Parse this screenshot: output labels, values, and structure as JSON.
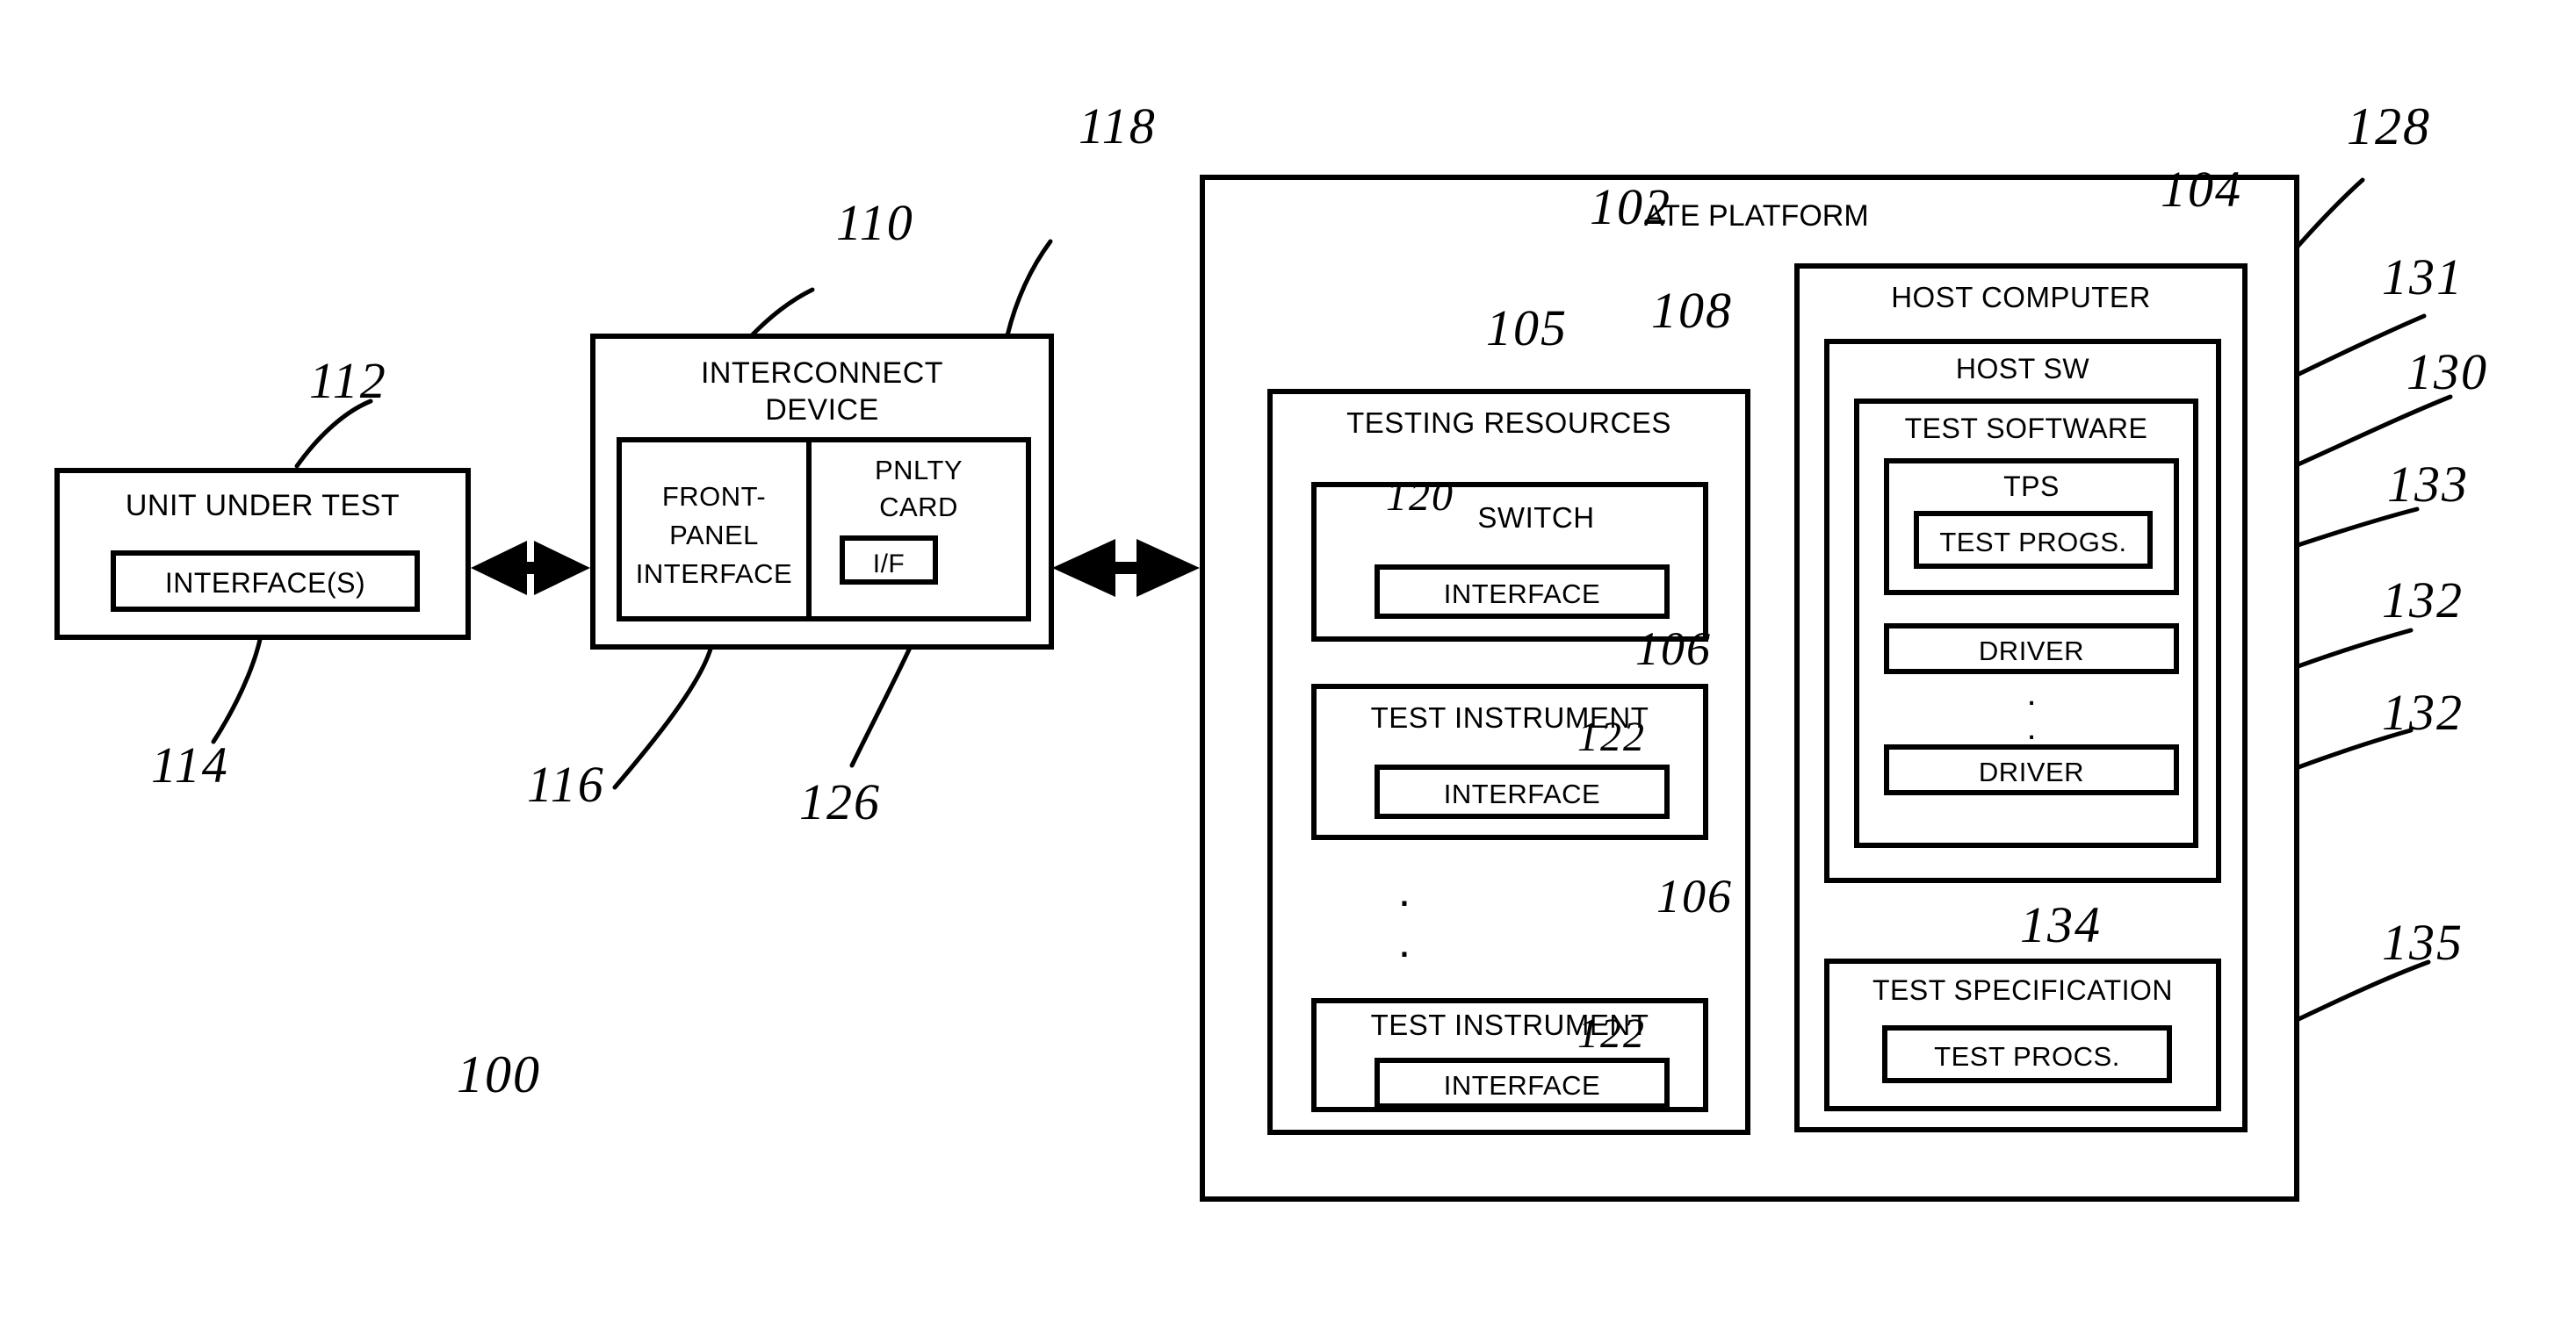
{
  "figure": {
    "system_ref": "100",
    "dots_glyph": "."
  },
  "uut": {
    "title": "UNIT UNDER TEST",
    "ref": "112",
    "interface": {
      "label": "INTERFACE(S)",
      "ref": "114"
    }
  },
  "interconnect": {
    "title_line1": "INTERCONNECT",
    "title_line2": "DEVICE",
    "ref": "110",
    "front_panel": {
      "line1": "FRONT-",
      "line2": "PANEL",
      "line3": "INTERFACE",
      "ref": "116"
    },
    "pnlty_card": {
      "line1": "PNLTY",
      "line2": "CARD",
      "ref": "118",
      "interface": {
        "label": "I/F",
        "ref": "126"
      }
    }
  },
  "ate": {
    "title": "ATE PLATFORM",
    "ref": "102",
    "testing_resources": {
      "title": "TESTING RESOURCES",
      "ref": "105",
      "connector_ref": "108",
      "items": [
        {
          "title": "SWITCH",
          "ref": "120",
          "ref_inline": true,
          "interface": "INTERFACE",
          "interface_ref": ""
        },
        {
          "title": "TEST INSTRUMENT",
          "ref": "106",
          "ref_inline": false,
          "interface": "INTERFACE",
          "interface_ref": "122"
        },
        {
          "title": "TEST INSTRUMENT",
          "ref": "106",
          "ref_inline": false,
          "interface": "INTERFACE",
          "interface_ref": "122"
        }
      ]
    },
    "host_computer": {
      "title": "HOST COMPUTER",
      "ref": "104",
      "host_sw": {
        "title": "HOST SW",
        "ref": "128",
        "test_software": {
          "title": "TEST SOFTWARE",
          "ref": "131",
          "tps": {
            "title": "TPS",
            "ref": "130",
            "test_progs": {
              "label": "TEST PROGS.",
              "ref": "133"
            }
          },
          "drivers": [
            {
              "label": "DRIVER",
              "ref": "132"
            },
            {
              "label": "DRIVER",
              "ref": "132"
            }
          ]
        }
      },
      "test_specification": {
        "title": "TEST SPECIFICATION",
        "ref": "134",
        "test_procs": {
          "label": "TEST PROCS.",
          "ref": "135"
        }
      }
    }
  }
}
